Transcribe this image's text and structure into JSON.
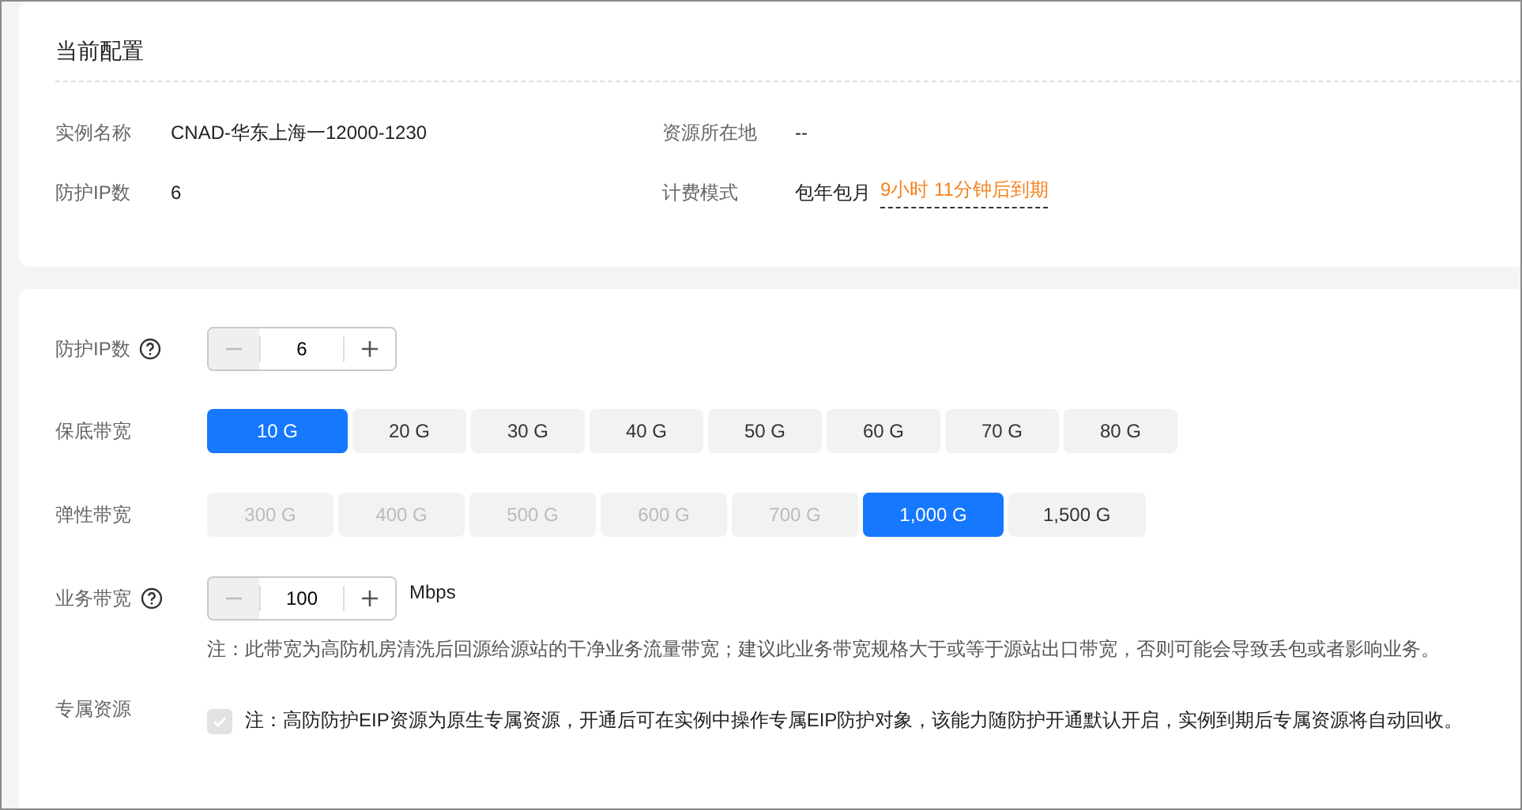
{
  "current_config": {
    "title": "当前配置",
    "fields": [
      {
        "label": "实例名称",
        "value": "CNAD-华东上海一12000-1230"
      },
      {
        "label": "资源所在地",
        "value": "--"
      },
      {
        "label": "防护IP数",
        "value": "6"
      },
      {
        "label": "计费模式",
        "value": "包年包月",
        "expiry": "9小时 11分钟后到期"
      }
    ]
  },
  "form": {
    "rows": [
      {
        "kind": "stepper",
        "label": "防护IP数",
        "help": true,
        "minus_disabled": true,
        "value": "6"
      },
      {
        "kind": "options",
        "label": "保底带宽",
        "options": [
          {
            "label": "10 G",
            "selected": true,
            "disabled": false
          },
          {
            "label": "20 G",
            "selected": false,
            "disabled": false
          },
          {
            "label": "30 G",
            "selected": false,
            "disabled": false
          },
          {
            "label": "40 G",
            "selected": false,
            "disabled": false
          },
          {
            "label": "50 G",
            "selected": false,
            "disabled": false
          },
          {
            "label": "60 G",
            "selected": false,
            "disabled": false
          },
          {
            "label": "70 G",
            "selected": false,
            "disabled": false
          },
          {
            "label": "80 G",
            "selected": false,
            "disabled": false
          }
        ]
      },
      {
        "kind": "options",
        "label": "弹性带宽",
        "options": [
          {
            "label": "300 G",
            "selected": false,
            "disabled": true
          },
          {
            "label": "400 G",
            "selected": false,
            "disabled": true
          },
          {
            "label": "500 G",
            "selected": false,
            "disabled": true
          },
          {
            "label": "600 G",
            "selected": false,
            "disabled": true
          },
          {
            "label": "700 G",
            "selected": false,
            "disabled": true
          },
          {
            "label": "1,000 G",
            "selected": true,
            "disabled": false
          },
          {
            "label": "1,500 G",
            "selected": false,
            "disabled": false
          }
        ]
      },
      {
        "kind": "stepper",
        "label": "业务带宽",
        "help": true,
        "minus_disabled": true,
        "value": "100",
        "unit": "Mbps",
        "note": "注：此带宽为高防机房清洗后回源给源站的干净业务流量带宽；建议此业务带宽规格大于或等于源站出口带宽，否则可能会导致丢包或者影响业务。"
      },
      {
        "kind": "checkbox",
        "label": "专属资源",
        "checked": true,
        "disabled": true,
        "note": "注：高防防护EIP资源为原生专属资源，开通后可在实例中操作专属EIP防护对象，该能力随防护开通默认开启，实例到期后专属资源将自动回收。"
      }
    ]
  }
}
